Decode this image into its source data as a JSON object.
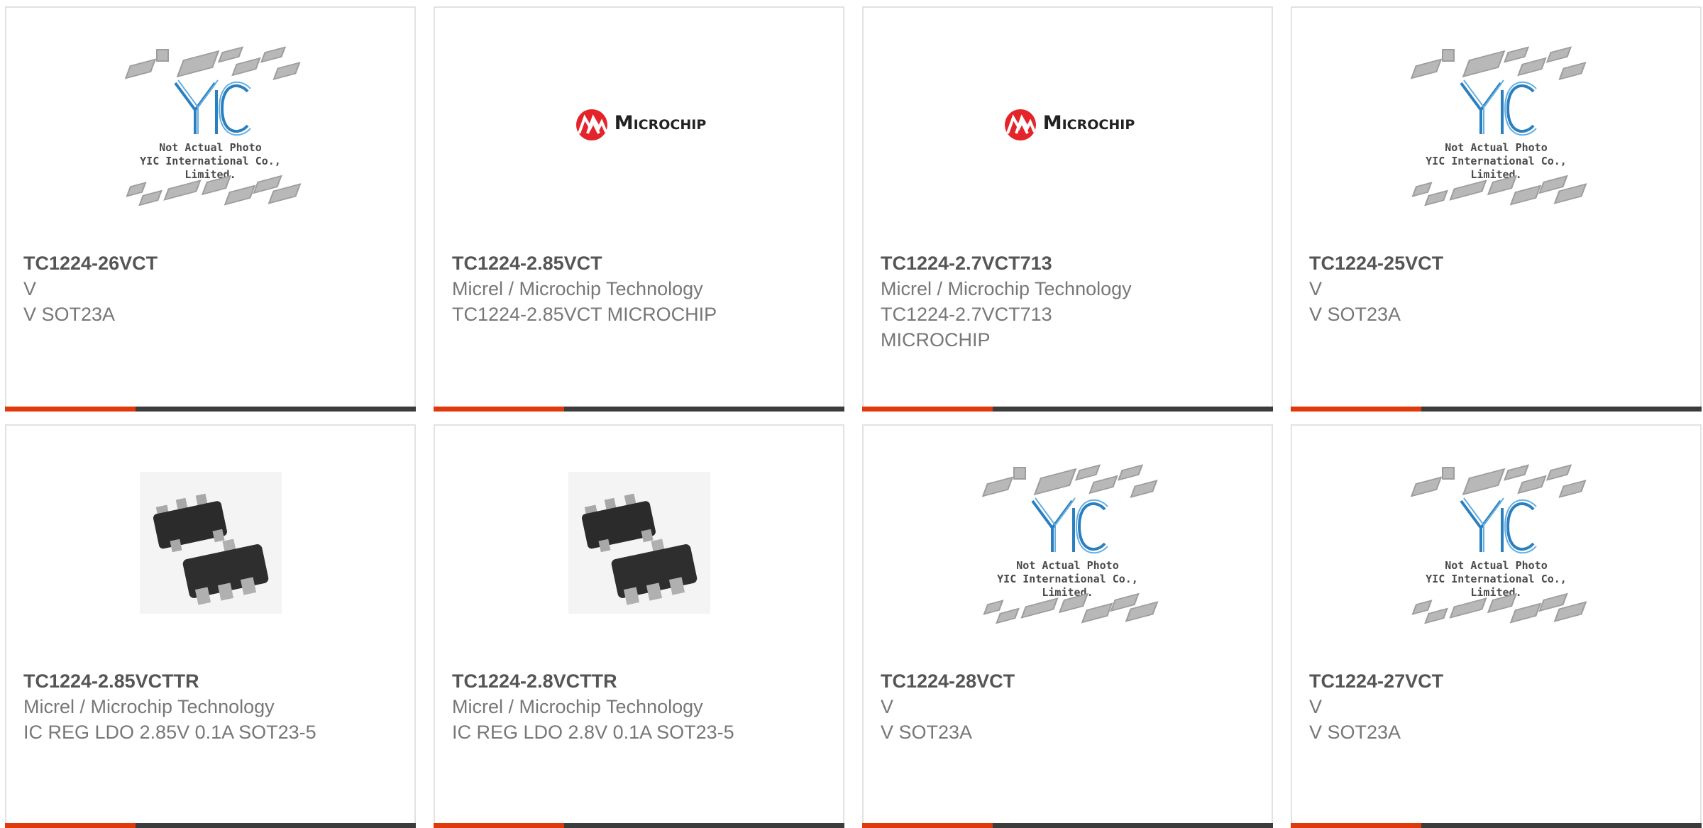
{
  "colors": {
    "accent": "#e03a0c",
    "bar": "#3c3c3c",
    "border": "#e2e2e2",
    "part_text": "#555555",
    "body_text": "#777777",
    "microchip_red": "#e4242b"
  },
  "placeholder": {
    "line1": "Not Actual Photo",
    "line2": "YIC International Co., Limited.",
    "logo_text": "YIC"
  },
  "microchip_logo_text": "Microchip",
  "products": [
    {
      "part": "TC1224-26VCT",
      "manufacturer": "V",
      "description": "V SOT23A",
      "image": "yic-placeholder"
    },
    {
      "part": "TC1224-2.85VCT",
      "manufacturer": "Micrel / Microchip Technology",
      "description": "TC1224-2.85VCT MICROCHIP",
      "image": "microchip-logo"
    },
    {
      "part": "TC1224-2.7VCT713",
      "manufacturer": "Micrel / Microchip Technology",
      "description": "TC1224-2.7VCT713 MICROCHIP",
      "image": "microchip-logo"
    },
    {
      "part": "TC1224-25VCT",
      "manufacturer": "V",
      "description": "V SOT23A",
      "image": "yic-placeholder"
    },
    {
      "part": "TC1224-2.85VCTTR",
      "manufacturer": "Micrel / Microchip Technology",
      "description": "IC REG LDO 2.85V 0.1A SOT23-5",
      "image": "sot23-photo"
    },
    {
      "part": "TC1224-2.8VCTTR",
      "manufacturer": "Micrel / Microchip Technology",
      "description": "IC REG LDO 2.8V 0.1A SOT23-5",
      "image": "sot23-photo"
    },
    {
      "part": "TC1224-28VCT",
      "manufacturer": "V",
      "description": "V SOT23A",
      "image": "yic-placeholder"
    },
    {
      "part": "TC1224-27VCT",
      "manufacturer": "V",
      "description": "V SOT23A",
      "image": "yic-placeholder"
    }
  ]
}
